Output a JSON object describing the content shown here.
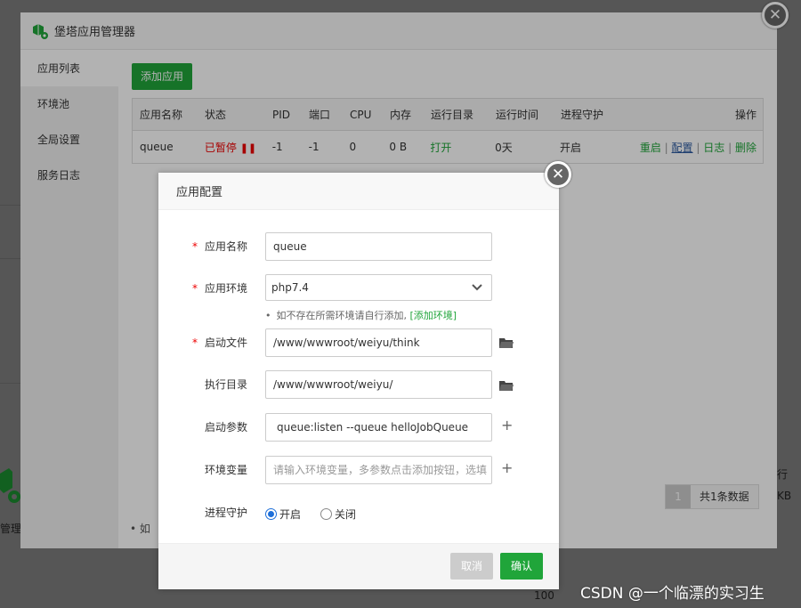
{
  "window": {
    "title": "堡塔应用管理器",
    "close_icon": "close-icon"
  },
  "sidebar": {
    "items": [
      {
        "label": "应用列表",
        "active": true
      },
      {
        "label": "环境池",
        "active": false
      },
      {
        "label": "全局设置",
        "active": false
      },
      {
        "label": "服务日志",
        "active": false
      }
    ]
  },
  "main": {
    "add_button": "添加应用",
    "table": {
      "headers": [
        "应用名称",
        "状态",
        "PID",
        "端口",
        "CPU",
        "内存",
        "运行目录",
        "运行时间",
        "进程守护",
        "操作"
      ],
      "rows": [
        {
          "name": "queue",
          "status": "已暂停",
          "pid": "-1",
          "port": "-1",
          "cpu": "0",
          "mem": "0 B",
          "dir": "打开",
          "time": "0天",
          "guard": "开启",
          "ops": [
            "重启",
            "配置",
            "日志",
            "删除"
          ]
        }
      ]
    },
    "pager": {
      "page": "1",
      "info": "共1条数据"
    },
    "bottom_note": "• 如"
  },
  "background": {
    "left_text": "管理器",
    "right_text": "KB",
    "right_text2": "行",
    "axis_100": "100"
  },
  "dialog": {
    "title": "应用配置",
    "fields": {
      "app_name": {
        "label": "应用名称",
        "value": "queue",
        "required": true
      },
      "app_env": {
        "label": "应用环境",
        "value": "php7.4",
        "required": true
      },
      "env_hint": {
        "text": "如不存在所需环境请自行添加,",
        "link": "[添加环境]"
      },
      "start_file": {
        "label": "启动文件",
        "value": "/www/wwwroot/weiyu/think",
        "required": true
      },
      "exec_dir": {
        "label": "执行目录",
        "value": "/www/wwwroot/weiyu/",
        "required": false
      },
      "start_args": {
        "label": "启动参数",
        "value": "queue:listen --queue helloJobQueue",
        "required": false
      },
      "env_vars": {
        "label": "环境变量",
        "placeholder": "请输入环境变量，多参数点击添加按钮，选填",
        "required": false
      },
      "guard": {
        "label": "进程守护",
        "options": [
          "开启",
          "关闭"
        ],
        "selected": "开启"
      }
    },
    "cancel": "取消",
    "confirm": "确认"
  },
  "watermark": "CSDN @一个临漂的实习生",
  "colors": {
    "accent": "#20a53a",
    "danger": "#ee0000",
    "link_blue": "#2c5aa0"
  }
}
